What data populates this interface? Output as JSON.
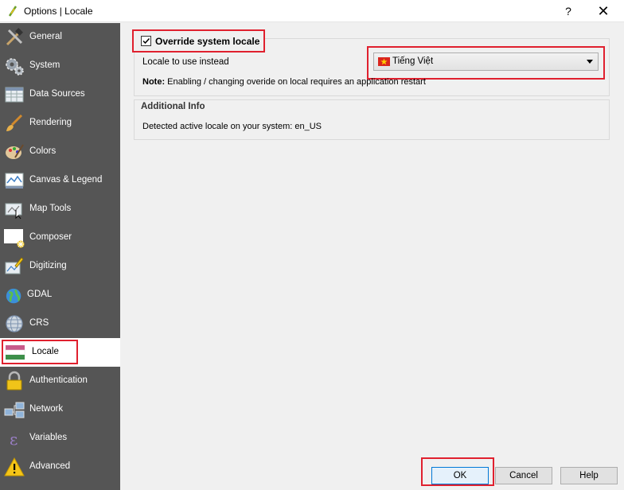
{
  "window": {
    "title": "Options | Locale",
    "help_glyph": "?",
    "close_glyph": "✕"
  },
  "sidebar": {
    "items": [
      {
        "label": "General",
        "icon": "tools-icon"
      },
      {
        "label": "System",
        "icon": "gears-icon"
      },
      {
        "label": "Data Sources",
        "icon": "table-icon"
      },
      {
        "label": "Rendering",
        "icon": "brush-icon"
      },
      {
        "label": "Colors",
        "icon": "palette-icon"
      },
      {
        "label": "Canvas & Legend",
        "icon": "canvas-icon"
      },
      {
        "label": "Map Tools",
        "icon": "map-tools-icon"
      },
      {
        "label": "Composer",
        "icon": "composer-icon"
      },
      {
        "label": "Digitizing",
        "icon": "digitizing-icon"
      },
      {
        "label": "GDAL",
        "icon": "globe-icon"
      },
      {
        "label": "CRS",
        "icon": "crs-globe-icon"
      },
      {
        "label": "Locale",
        "icon": "flag-icon"
      },
      {
        "label": "Authentication",
        "icon": "padlock-icon"
      },
      {
        "label": "Network",
        "icon": "network-icon"
      },
      {
        "label": "Variables",
        "icon": "epsilon-icon"
      },
      {
        "label": "Advanced",
        "icon": "warning-icon"
      }
    ],
    "selected": "Locale"
  },
  "locale": {
    "override_label": "Override system locale",
    "override_checked": true,
    "locale_label": "Locale to use instead",
    "selected_locale": "Tiếng Việt",
    "note_bold": "Note:",
    "note_text": " Enabling / changing overide on local requires an application restart",
    "additional_info_title": "Additional Info",
    "detected_text": "Detected active locale on your system: en_US"
  },
  "buttons": {
    "ok": "OK",
    "cancel": "Cancel",
    "help": "Help"
  },
  "colors": {
    "sidebar_bg": "#555555",
    "highlight": "#e0202e",
    "ok_border": "#0078d7"
  }
}
